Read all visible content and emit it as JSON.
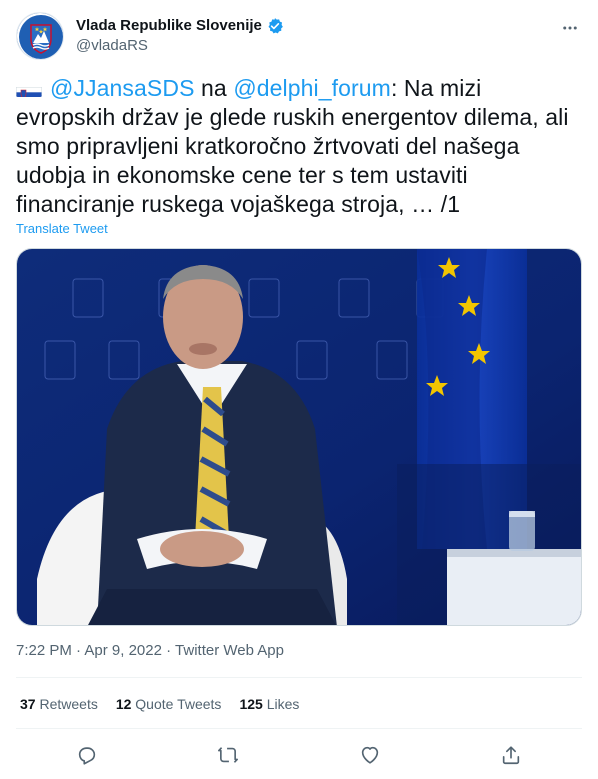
{
  "account": {
    "display_name": "Vlada Republike Slovenije",
    "handle": "@vladaRS",
    "verified_icon": "verified-badge-icon"
  },
  "tweet": {
    "mention1": "@JJansaSDS",
    "word_na": "na",
    "mention2": "@delphi_forum",
    "body": ": Na mizi evropskih držav je glede ruskih energentov dilema, ali smo pripravljeni kratkoročno žrtvovati del našega udobja in ekonomske cene ter s tem ustaviti financiranje ruskega vojaškega stroja, … /1",
    "translate_label": "Translate Tweet"
  },
  "media": {
    "description_icon": "photo"
  },
  "meta": {
    "time": "7:22 PM",
    "sep": "·",
    "date": "Apr 9, 2022",
    "app": "Twitter Web App"
  },
  "stats": {
    "retweets_count": "37",
    "retweets_label": "Retweets",
    "quotes_count": "12",
    "quotes_label": "Quote Tweets",
    "likes_count": "125",
    "likes_label": "Likes"
  },
  "colors": {
    "accent": "#1d9bf0",
    "text": "#0f1419",
    "muted": "#536471"
  }
}
